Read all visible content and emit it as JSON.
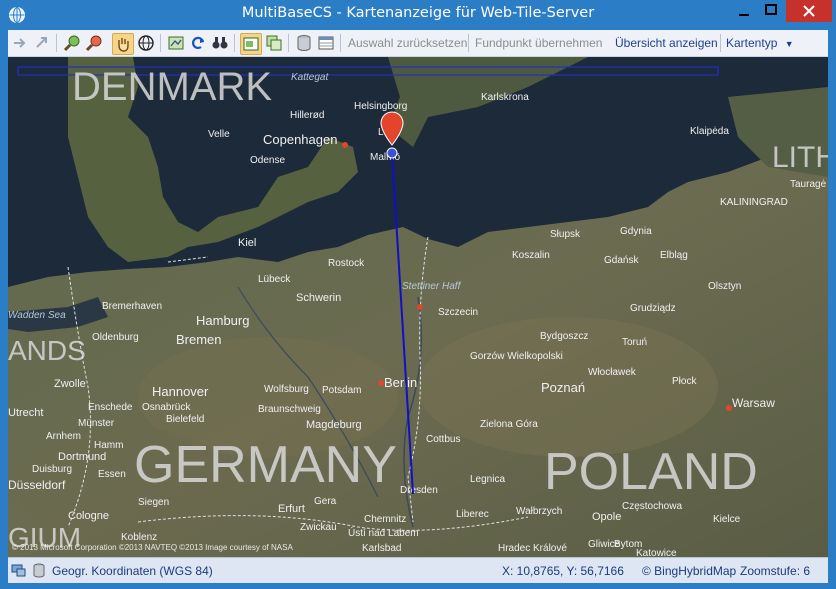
{
  "window": {
    "title": "MultiBaseCS - Kartenanzeige für Web-Tile-Server"
  },
  "toolbar": {
    "buttons": [
      {
        "icon": "import-icon"
      },
      {
        "icon": "export-icon"
      },
      {
        "icon": "zoom-in-icon"
      },
      {
        "icon": "zoom-out-icon"
      },
      {
        "icon": "pan-hand-icon"
      },
      {
        "icon": "globe-icon"
      },
      {
        "icon": "map-layer-icon"
      },
      {
        "icon": "refresh-icon"
      },
      {
        "icon": "binoculars-icon"
      },
      {
        "icon": "overview-map-icon"
      },
      {
        "icon": "layers-icon"
      },
      {
        "icon": "database-icon"
      },
      {
        "icon": "table-icon"
      }
    ],
    "reset_selection": "Auswahl zurücksetzen",
    "accept_point": "Fundpunkt übernehmen",
    "show_overview": "Übersicht anzeigen",
    "map_type": "Kartentyp"
  },
  "map": {
    "countries": [
      "DENMARK",
      "GERMANY",
      "POLAND",
      "ANDS",
      "GIUM",
      "LITH"
    ],
    "seas": [
      "Kattegat",
      "Stettiner Haff",
      "Wadden Sea"
    ],
    "cities": [
      "Helsingborg",
      "Hillerød",
      "Copenhagen",
      "Lund",
      "Malmö",
      "Karlskrona",
      "Klaipėda",
      "Tauragė",
      "KALININGRAD",
      "Velle",
      "Odense",
      "Kiel",
      "Lübeck",
      "Rostock",
      "Schwerin",
      "Hamburg",
      "Bremerhaven",
      "Bremen",
      "Oldenburg",
      "Szczecin",
      "Słupsk",
      "Gdynia",
      "Gdańsk",
      "Elbląg",
      "Koszalin",
      "Olsztyn",
      "Grudziądz",
      "Bydgoszcz",
      "Toruń",
      "Gorzów Wielkopolski",
      "Poznań",
      "Włocławek",
      "Płock",
      "Warsaw",
      "Berlin",
      "Potsdam",
      "Wolfsburg",
      "Hannover",
      "Braunschweig",
      "Magdeburg",
      "Zwolle",
      "Osnabrück",
      "Bielefeld",
      "Enschede",
      "Utrecht",
      "Münster",
      "Arnhem",
      "Hamm",
      "Dortmund",
      "Essen",
      "Duisburg",
      "Düsseldorf",
      "Siegen",
      "Cologne",
      "Koblenz",
      "Erfurt",
      "Gera",
      "Zwickau",
      "Chemnitz",
      "Dresden",
      "Cottbus",
      "Zielona Góra",
      "Legnica",
      "Wałbrzych",
      "Opole",
      "Częstochowa",
      "Kielce",
      "Gliwice",
      "Katowice",
      "Liberec",
      "Ústí nad Labem",
      "Karlsbad",
      "Hradec Králové",
      "Bytom"
    ],
    "copyright": "© 2013 Microsoft Corporation  ©2013 NAVTEQ  ©2013 Image courtesy of NASA"
  },
  "status": {
    "coord_system": "Geogr. Koordinaten (WGS 84)",
    "coordinates": "X: 10,8765, Y: 56,7166",
    "provider": "© BingHybridMap",
    "zoom": "Zoomstufe: 6"
  },
  "colors": {
    "titlebar": "#2b7dc6",
    "close_button": "#c7312c",
    "route_line": "#1010c8",
    "marker_red": "#e2452c",
    "marker_blue": "#3c4fd8",
    "link_text": "#1f3f8a"
  }
}
